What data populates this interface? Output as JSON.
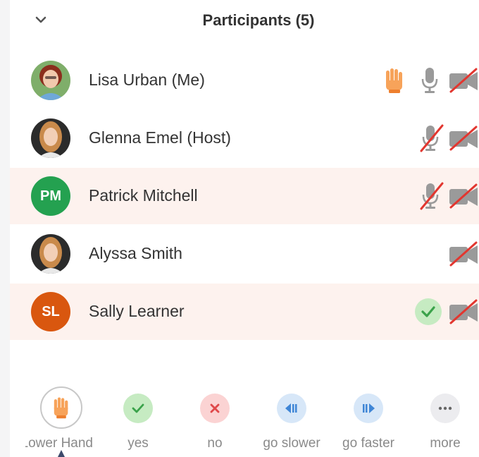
{
  "panel": {
    "title": "Participants (5)"
  },
  "participants": [
    {
      "name": "Lisa Urban (Me)",
      "avatar": "photo",
      "raised_hand": true,
      "mic": "on",
      "video": "off"
    },
    {
      "name": "Glenna Emel  (Host)",
      "avatar": "photo",
      "mic": "muted",
      "video": "off"
    },
    {
      "name": "Patrick Mitchell",
      "avatar_initials": "PM",
      "avatar_color": "#24a150",
      "mic": "muted",
      "video": "off"
    },
    {
      "name": "Alyssa Smith",
      "avatar": "photo",
      "video": "off"
    },
    {
      "name": "Sally Learner",
      "avatar_initials": "SL",
      "avatar_color": "#d9570f",
      "status": "yes",
      "video": "off"
    }
  ],
  "reactions": [
    {
      "label": "Lower Hand",
      "icon": "hand-icon"
    },
    {
      "label": "yes",
      "icon": "check-icon"
    },
    {
      "label": "no",
      "icon": "x-icon"
    },
    {
      "label": "go slower",
      "icon": "rewind-icon"
    },
    {
      "label": "go faster",
      "icon": "fast-forward-icon"
    },
    {
      "label": "more",
      "icon": "ellipsis-icon"
    }
  ],
  "colors": {
    "highlight_row": "#fdf2ee",
    "hand": "#f7a35a",
    "yes_green": "#3aa24a",
    "no_red": "#e0484a",
    "speed_blue": "#3f86d6",
    "muted_red": "#e2362f"
  }
}
